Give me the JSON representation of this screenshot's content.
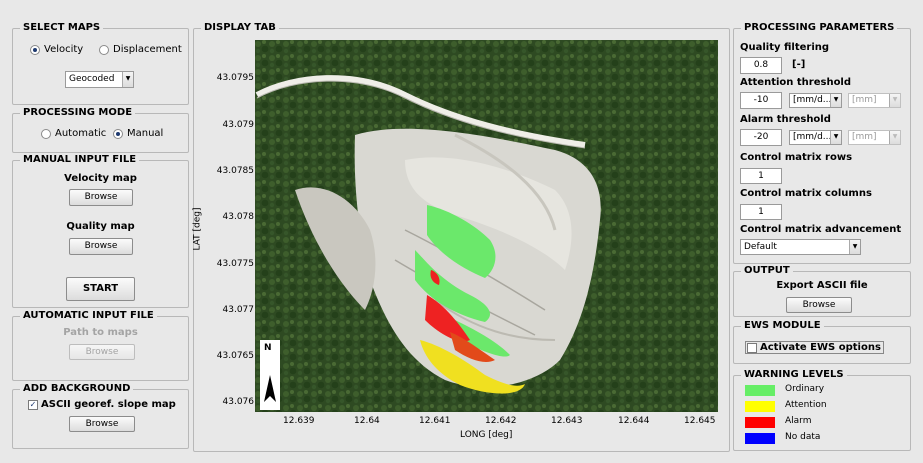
{
  "select_maps": {
    "title": "SELECT MAPS",
    "velocity_label": "Velocity",
    "displacement_label": "Displacement",
    "projection_value": "Geocoded"
  },
  "processing_mode": {
    "title": "PROCESSING MODE",
    "automatic_label": "Automatic",
    "manual_label": "Manual"
  },
  "manual_input": {
    "title": "MANUAL INPUT FILE",
    "velocity_label": "Velocity map",
    "velocity_browse": "Browse",
    "quality_label": "Quality map",
    "quality_browse": "Browse",
    "start_label": "START"
  },
  "automatic_input": {
    "title": "AUTOMATIC INPUT FILE",
    "path_label": "Path to maps",
    "browse": "Browse"
  },
  "add_background": {
    "title": "ADD BACKGROUND",
    "checkbox_label": "ASCII georef. slope map",
    "browse": "Browse"
  },
  "display": {
    "title": "DISPLAY TAB",
    "ylabel": "LAT [deg]",
    "xlabel": "LONG [deg]",
    "yticks": [
      "43.0795",
      "43.079",
      "43.0785",
      "43.078",
      "43.0775",
      "43.077",
      "43.0765",
      "43.076"
    ],
    "xticks": [
      "12.639",
      "12.64",
      "12.641",
      "12.642",
      "12.643",
      "12.644",
      "12.645"
    ],
    "north": "N"
  },
  "processing_params": {
    "title": "PROCESSING PARAMETERS",
    "quality_label": "Quality filtering",
    "quality_value": "0.8",
    "quality_unit": "[-]",
    "attention_label": "Attention threshold",
    "attention_value": "-10",
    "attention_unit1": "[mm/d...",
    "attention_unit2": "[mm]",
    "alarm_label": "Alarm threshold",
    "alarm_value": "-20",
    "alarm_unit1": "[mm/d...",
    "alarm_unit2": "[mm]",
    "rows_label": "Control matrix rows",
    "rows_value": "1",
    "cols_label": "Control matrix columns",
    "cols_value": "1",
    "adv_label": "Control matrix advancement",
    "adv_value": "Default"
  },
  "output": {
    "title": "OUTPUT",
    "export_label": "Export ASCII file",
    "browse": "Browse"
  },
  "ews": {
    "title": "EWS MODULE",
    "checkbox_label": "Activate EWS options"
  },
  "warning_levels": {
    "title": "WARNING LEVELS",
    "items": [
      {
        "label": "Ordinary",
        "color": "#66ee66"
      },
      {
        "label": "Attention",
        "color": "#ffff00"
      },
      {
        "label": "Alarm",
        "color": "#ff0000"
      },
      {
        "label": "No data",
        "color": "#0000ff"
      }
    ]
  }
}
